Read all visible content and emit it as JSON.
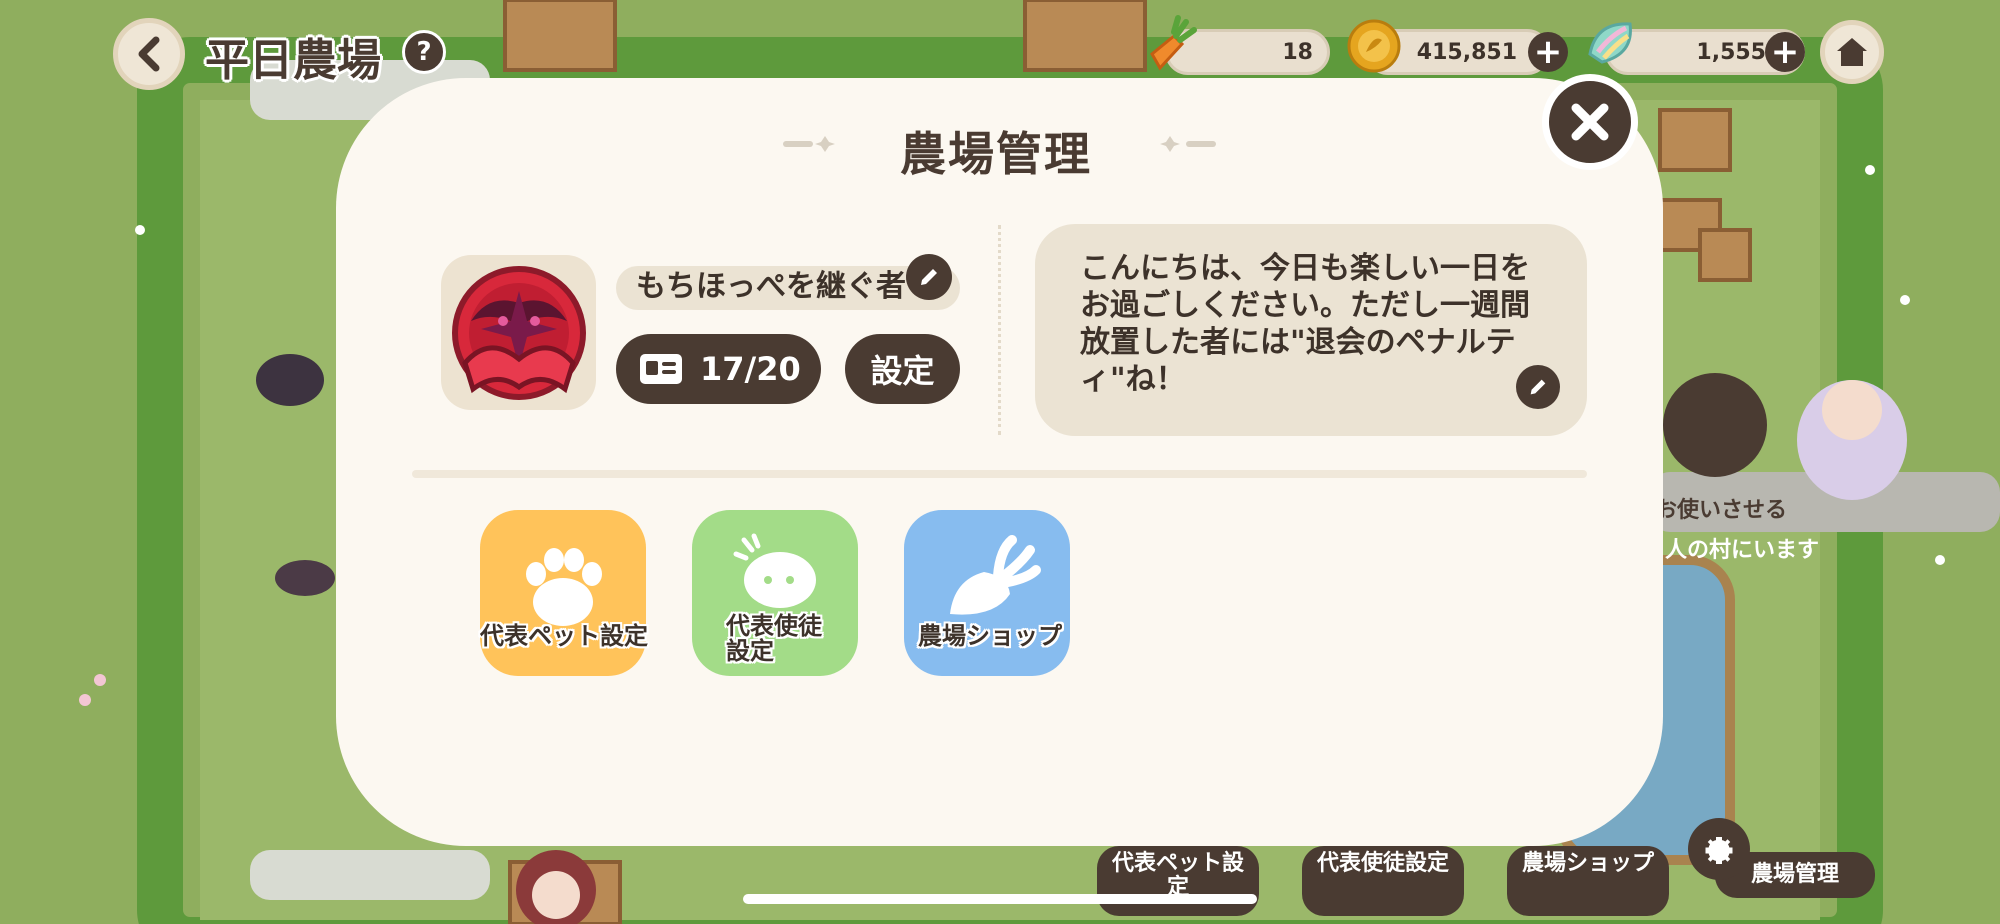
{
  "hud": {
    "farm_title": "平日農場",
    "help_label": "?",
    "carrots": "18",
    "coins": "415,851",
    "gems": "1,555"
  },
  "modal": {
    "title": "農場管理",
    "farm_name": "もちほっぺを継ぐ者",
    "members": "17/20",
    "settings_label": "設定",
    "message": "こんにちは、今日も楽しい一日をお過ごしください。ただし一週間放置した者には\"退会のペナルティ\"ね！",
    "features": [
      {
        "label": "代表ペット設定",
        "color": "#ffc35a"
      },
      {
        "label": "代表使徒設定",
        "color": "#a3dc88"
      },
      {
        "label": "農場ショップ",
        "color": "#87bcef"
      }
    ]
  },
  "background": {
    "bottom_menu": [
      "代表ペット設定",
      "代表使徒設定",
      "農場ショップ",
      "農場管理"
    ],
    "banner_text": "お使いさせる",
    "village_text": "人の村にいます"
  },
  "colors": {
    "modal_bg": "#fcf8f1",
    "dark_brown": "#4a3b32",
    "panel_beige": "#ebe3d3",
    "grass": "#8fae5e"
  }
}
